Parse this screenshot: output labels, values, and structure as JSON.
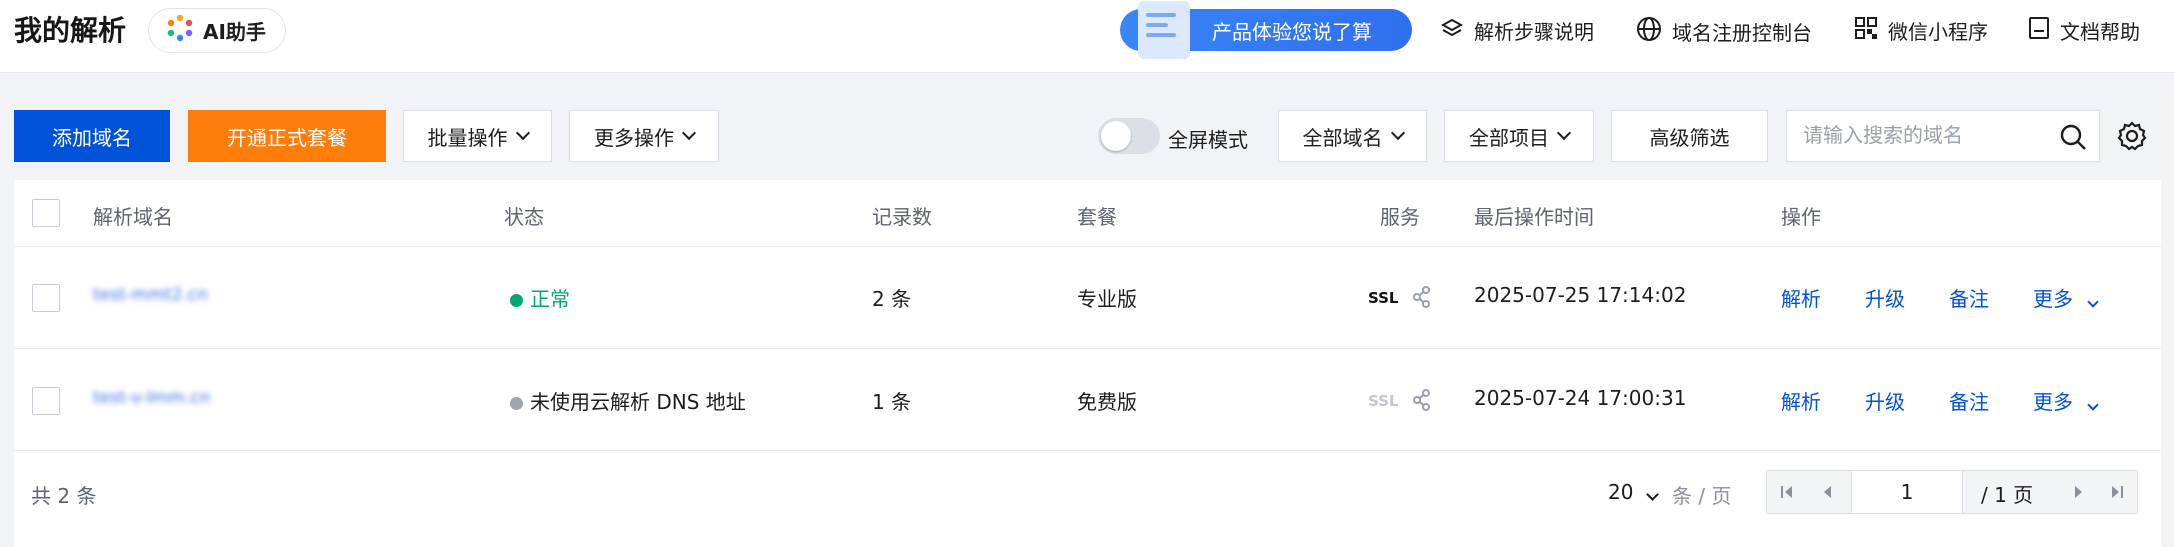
{
  "header": {
    "title": "我的解析",
    "ai_label": "AI助手",
    "promo_label": "产品体验您说了算",
    "links": [
      {
        "label": "解析步骤说明",
        "icon": "layers-icon"
      },
      {
        "label": "域名注册控制台",
        "icon": "globe-icon"
      },
      {
        "label": "微信小程序",
        "icon": "qrcode-icon"
      },
      {
        "label": "文档帮助",
        "icon": "document-icon"
      }
    ]
  },
  "toolbar": {
    "add_domain": "添加域名",
    "open_plan": "开通正式套餐",
    "batch_ops": "批量操作",
    "more_ops": "更多操作",
    "fullscreen_label": "全屏模式",
    "fullscreen_on": false,
    "all_domains": "全部域名",
    "all_projects": "全部项目",
    "advanced_filter": "高级筛选",
    "search_placeholder": "请输入搜索的域名",
    "search_value": ""
  },
  "table": {
    "columns": [
      "解析域名",
      "状态",
      "记录数",
      "套餐",
      "服务",
      "最后操作时间",
      "操作"
    ],
    "rows": [
      {
        "domain": "test-mmt2.cn",
        "status": "正常",
        "status_color": "#00a870",
        "records": "2 条",
        "plan": "专业版",
        "ssl": "SSL",
        "ssl_active": true,
        "time": "2025-07-25 17:14:02",
        "actions": {
          "resolve": "解析",
          "upgrade": "升级",
          "note": "备注",
          "more": "更多"
        }
      },
      {
        "domain": "test-v-lmm.cn",
        "status": "未使用云解析 DNS 地址",
        "status_color": "#a0a4ab",
        "records": "1 条",
        "plan": "免费版",
        "ssl": "SSL",
        "ssl_active": false,
        "time": "2025-07-24 17:00:31",
        "actions": {
          "resolve": "解析",
          "upgrade": "升级",
          "note": "备注",
          "more": "更多"
        }
      }
    ]
  },
  "footer": {
    "total": "共 2 条",
    "page_size": "20",
    "per_page_unit": "条 / 页",
    "current_page": "1",
    "total_pages": "/ 1 页"
  },
  "colors": {
    "primary": "#0052d9",
    "orange": "#ff7d0a",
    "success": "#00a870"
  }
}
